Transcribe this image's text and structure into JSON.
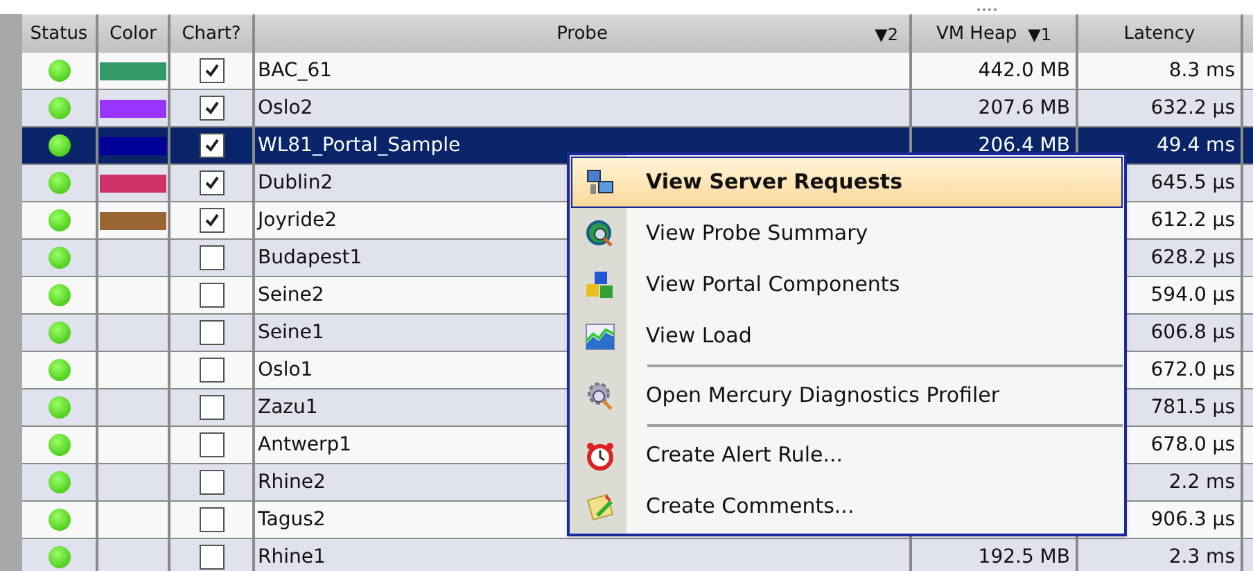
{
  "table": {
    "columns": [
      {
        "label": "Status"
      },
      {
        "label": "Color"
      },
      {
        "label": "Chart?"
      },
      {
        "label": "Probe",
        "sort": "▼2"
      },
      {
        "label": "VM Heap",
        "sort": "▼1"
      },
      {
        "label": "Latency"
      }
    ],
    "rows": [
      {
        "color": "#339966",
        "chart": true,
        "probe": "BAC_61",
        "heap": "442.0 MB",
        "latency": "8.3 ms",
        "selected": false
      },
      {
        "color": "#9933ff",
        "chart": true,
        "probe": "Oslo2",
        "heap": "207.6 MB",
        "latency": "632.2 µs",
        "selected": false
      },
      {
        "color": "#000099",
        "chart": true,
        "probe": "WL81_Portal_Sample",
        "heap": "206.4 MB",
        "latency": "49.4 ms",
        "selected": true
      },
      {
        "color": "#cc3366",
        "chart": true,
        "probe": "Dublin2",
        "latency": "645.5 µs",
        "selected": false
      },
      {
        "color": "#996633",
        "chart": true,
        "probe": "Joyride2",
        "latency": "612.2 µs",
        "selected": false
      },
      {
        "chart": false,
        "probe": "Budapest1",
        "latency": "628.2 µs",
        "selected": false
      },
      {
        "chart": false,
        "probe": "Seine2",
        "latency": "594.0 µs",
        "selected": false
      },
      {
        "chart": false,
        "probe": "Seine1",
        "latency": "606.8 µs",
        "selected": false
      },
      {
        "chart": false,
        "probe": "Oslo1",
        "latency": "672.0 µs",
        "selected": false
      },
      {
        "chart": false,
        "probe": "Zazu1",
        "latency": "781.5 µs",
        "selected": false
      },
      {
        "chart": false,
        "probe": "Antwerp1",
        "latency": "678.0 µs",
        "selected": false
      },
      {
        "chart": false,
        "probe": "Rhine2",
        "latency": "2.2 ms",
        "selected": false
      },
      {
        "chart": false,
        "probe": "Tagus2",
        "latency": "906.3 µs",
        "selected": false
      },
      {
        "chart": false,
        "probe": "Rhine1",
        "heap": "192.5 MB",
        "latency": "2.3 ms",
        "selected": false
      }
    ]
  },
  "context_menu": {
    "items": [
      {
        "kind": "item",
        "label": "View Server Requests",
        "selected": true
      },
      {
        "kind": "item",
        "label": "View Probe Summary",
        "selected": false
      },
      {
        "kind": "item",
        "label": "View Portal Components",
        "selected": false
      },
      {
        "kind": "item",
        "label": "View Load",
        "selected": false
      },
      {
        "kind": "separator"
      },
      {
        "kind": "item",
        "label": "Open Mercury Diagnostics Profiler",
        "selected": false
      },
      {
        "kind": "separator"
      },
      {
        "kind": "item",
        "label": "Create Alert Rule...",
        "selected": false
      },
      {
        "kind": "item",
        "label": "Create Comments...",
        "selected": false
      }
    ]
  }
}
